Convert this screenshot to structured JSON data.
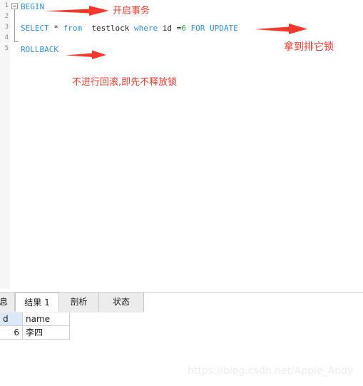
{
  "editor": {
    "line_numbers": [
      "1",
      "2",
      "3",
      "4",
      "5"
    ],
    "fold_widget": "minus",
    "lines": [
      {
        "n": 1,
        "tokens": [
          {
            "t": "BEGIN",
            "c": "kw"
          }
        ]
      },
      {
        "n": 2,
        "tokens": []
      },
      {
        "n": 3,
        "tokens": [
          {
            "t": "SELECT",
            "c": "kw"
          },
          {
            "t": " * ",
            "c": "op"
          },
          {
            "t": "from",
            "c": "kw"
          },
          {
            "t": "  testlock ",
            "c": "plain"
          },
          {
            "t": "where",
            "c": "kw"
          },
          {
            "t": " id =",
            "c": "plain"
          },
          {
            "t": "6",
            "c": "num"
          },
          {
            "t": " ",
            "c": "plain"
          },
          {
            "t": "FOR UPDATE",
            "c": "kw"
          }
        ]
      },
      {
        "n": 4,
        "tokens": []
      },
      {
        "n": 5,
        "tokens": [
          {
            "t": "ROLLBACK",
            "c": "kw"
          }
        ]
      }
    ],
    "line1_text": "BEGIN",
    "line3_text": "SELECT * from  testlock where id =6 FOR UPDATE",
    "line5_text": "ROLLBACK"
  },
  "annotations": {
    "accent_color": "#f2392c",
    "begin_note": "开启事务",
    "select_note": "拿到排它锁",
    "rollback_note": "不进行回滚,即先不释放锁"
  },
  "tabs": [
    {
      "label": "息",
      "active": false
    },
    {
      "label": "结果 1",
      "active": true
    },
    {
      "label": "剖析",
      "active": false
    },
    {
      "label": "状态",
      "active": false
    }
  ],
  "result_grid": {
    "columns": [
      "d",
      "name"
    ],
    "rows": [
      {
        "d": "6",
        "name": "李四"
      }
    ]
  },
  "watermark": {
    "text": "https://blog.csdn.net/Apple_Andy"
  }
}
